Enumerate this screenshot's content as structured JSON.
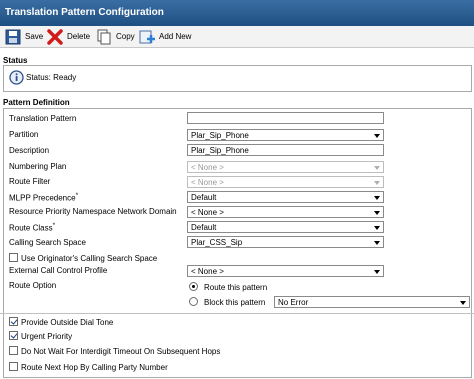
{
  "title": "Translation Pattern Configuration",
  "toolbar": {
    "save_label": "Save",
    "delete_label": "Delete",
    "copy_label": "Copy",
    "add_new_label": "Add New"
  },
  "status": {
    "section_title": "Status",
    "text": "Status: Ready"
  },
  "pattern": {
    "section_title": "Pattern Definition",
    "fields": {
      "translation_pattern": {
        "label": "Translation Pattern",
        "value": ""
      },
      "partition": {
        "label": "Partition",
        "value": "Plar_Sip_Phone"
      },
      "description": {
        "label": "Description",
        "value": "Plar_Sip_Phone"
      },
      "numbering_plan": {
        "label": "Numbering Plan",
        "value": "< None >"
      },
      "route_filter": {
        "label": "Route Filter",
        "value": "< None >"
      },
      "mlpp_precedence": {
        "label": "MLPP Precedence",
        "required": "*",
        "value": "Default"
      },
      "resource_priority": {
        "label": "Resource Priority Namespace Network Domain",
        "value": "< None >"
      },
      "route_class": {
        "label": "Route Class",
        "required": "*",
        "value": "Default"
      },
      "calling_search_space": {
        "label": "Calling Search Space",
        "value": "Plar_CSS_Sip"
      },
      "external_call_control": {
        "label": "External Call Control Profile",
        "value": "< None >"
      },
      "route_option": {
        "label": "Route Option",
        "route_label": "Route this pattern",
        "block_label": "Block this pattern",
        "block_reason": "No Error"
      }
    },
    "checkboxes": {
      "use_originator_css": "Use Originator's Calling Search Space",
      "provide_outside_dial_tone": "Provide Outside Dial Tone",
      "urgent_priority": "Urgent Priority",
      "do_not_wait": "Do Not Wait For Interdigit Timeout On Subsequent Hops",
      "route_next_hop": "Route Next Hop By Calling Party Number"
    }
  }
}
